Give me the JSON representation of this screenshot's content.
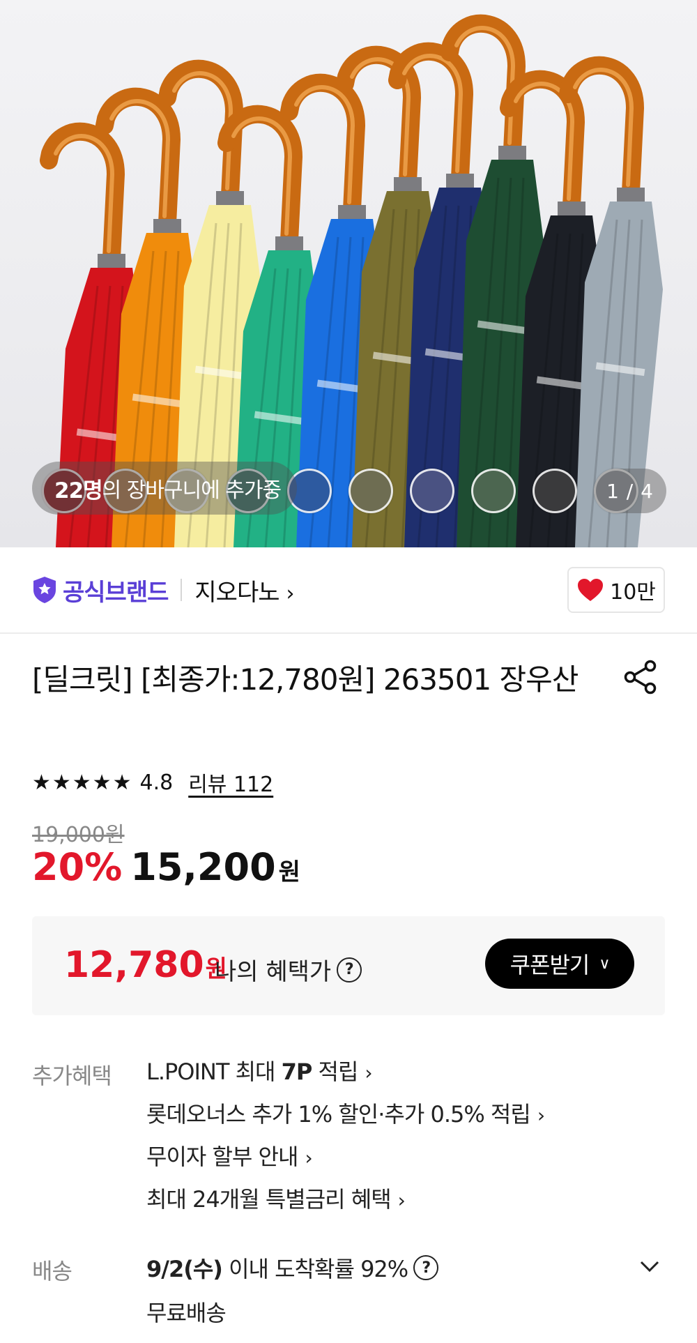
{
  "hero": {
    "cart_count": "22명",
    "cart_text": "의 장바구니에 추가중",
    "counter": "1 / 4",
    "swatch_colors": [
      "#8a1a22",
      "#a9764a",
      "#c9c2a0",
      "#3b6e63",
      "#2d5aa0",
      "#6e6d52",
      "#4a5282",
      "#4c6650",
      "#3a3a3c",
      "#8a8f96"
    ],
    "umbrella_colors": [
      "#d4141c",
      "#f08c0c",
      "#f6eda0",
      "#22b185",
      "#1a6fe0",
      "#7a7030",
      "#1f2f6e",
      "#1e4d32",
      "#1c1f26",
      "#9eaab4"
    ]
  },
  "brand": {
    "official_label": "공식브랜드",
    "name": "지오다노",
    "likes": "10만"
  },
  "product": {
    "title": "[딜크릿] [최종가:12,780원] 263501 장우산",
    "rating": "4.8",
    "review": "리뷰 112",
    "original_price": "19,000원",
    "discount": "20%",
    "price": "15,200",
    "price_unit": "원"
  },
  "my_benefit": {
    "price": "12,780",
    "unit": "원",
    "label": "나의 혜택가",
    "coupon_button": "쿠폰받기"
  },
  "extra_benefits": {
    "label": "추가혜택",
    "items": {
      "lpoint_prefix": "L.POINT 최대 ",
      "lpoint_bold": "7P",
      "lpoint_suffix": " 적립",
      "lotte_owners": "롯데오너스 추가 1% 할인·추가 0.5% 적립",
      "installment": "무이자 할부 안내",
      "special_rate": "최대 24개월 특별금리 혜택"
    }
  },
  "shipping": {
    "label": "배송",
    "date": "9/2(수)",
    "arrival_text": " 이내 도착확률 92%",
    "fee": "무료배송"
  }
}
